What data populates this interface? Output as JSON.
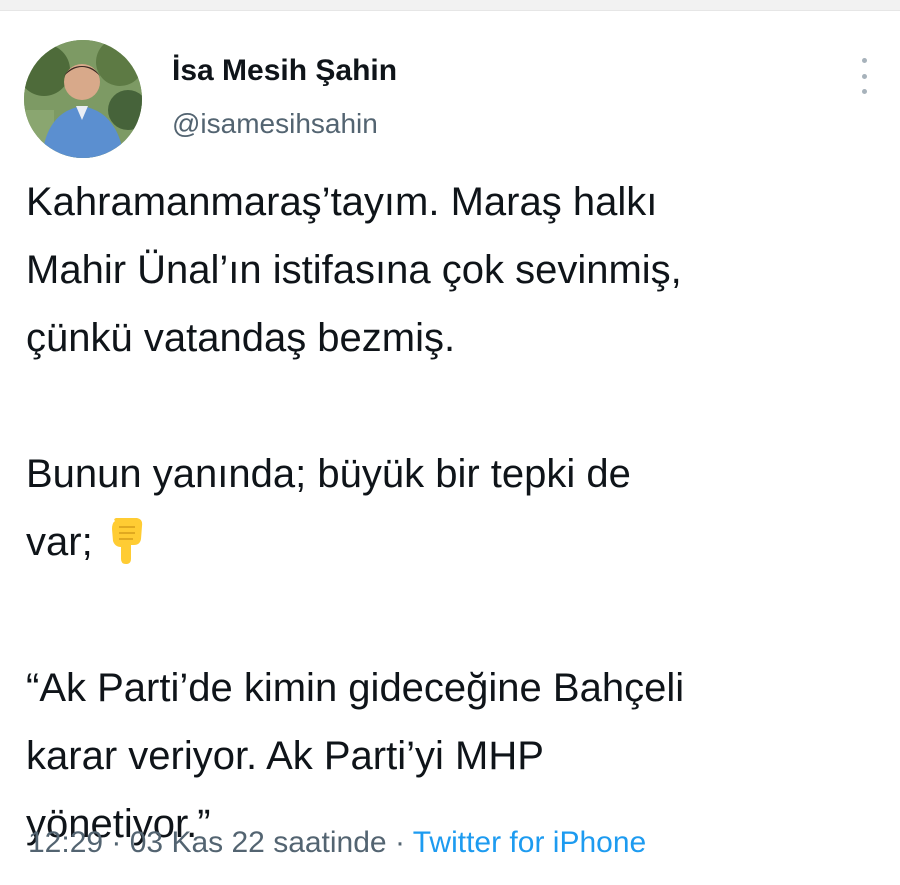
{
  "author": {
    "display_name": "İsa Mesih Şahin",
    "handle": "@isamesihsahin",
    "avatar_icon": "profile-avatar-icon"
  },
  "more_icon": "more-options-icon",
  "tweet": {
    "paragraph1_line1": "Kahramanmaraş’tayım. Maraş halkı",
    "paragraph1_line2": "Mahir Ünal’ın istifasına çok sevinmiş,",
    "paragraph1_line3": "çünkü vatandaş bezmiş.",
    "paragraph2_line1": "Bunun yanında; büyük bir tepki de",
    "paragraph2_line2": "var;",
    "emoji_icon": "pointing-down-hand-icon",
    "paragraph3_line1": "“Ak Parti’de kimin gideceğine Bahçeli",
    "paragraph3_line2": "karar veriyor. Ak Parti’yi MHP",
    "paragraph3_line3": "yönetiyor.”"
  },
  "meta": {
    "time": "12:29",
    "separator": " · ",
    "date": "03 Kas 22 saatinde",
    "source": "Twitter for iPhone"
  },
  "colors": {
    "text": "#0f1419",
    "secondary": "#536471",
    "link": "#1d9bf0",
    "emoji": "#ffcc33"
  }
}
